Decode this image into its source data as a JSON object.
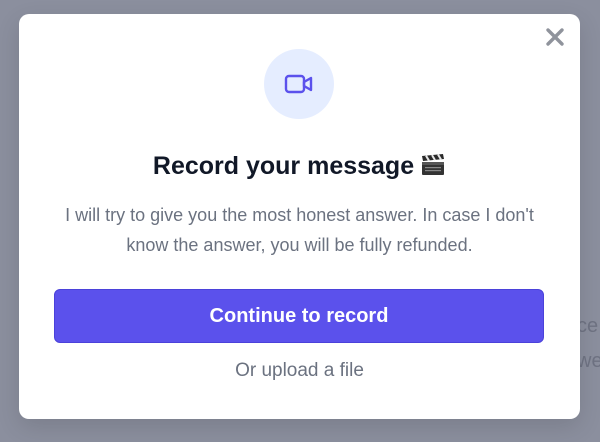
{
  "background": {
    "fragment_1": "ce",
    "fragment_2": "we"
  },
  "modal": {
    "title": "Record your message",
    "title_emoji": "clapper-board-icon",
    "description": "I will try to give you the most honest answer. In case I don't know the answer, you will be fully refunded.",
    "primary_button_label": "Continue to record",
    "secondary_link_label": "Or upload a file",
    "icon": "video-camera-icon",
    "close_icon": "close-icon"
  },
  "colors": {
    "accent": "#5b51ec",
    "icon_circle_bg": "#e5edff",
    "backdrop": "#8b8f9e",
    "title": "#111827",
    "muted_text": "#6b7280"
  }
}
